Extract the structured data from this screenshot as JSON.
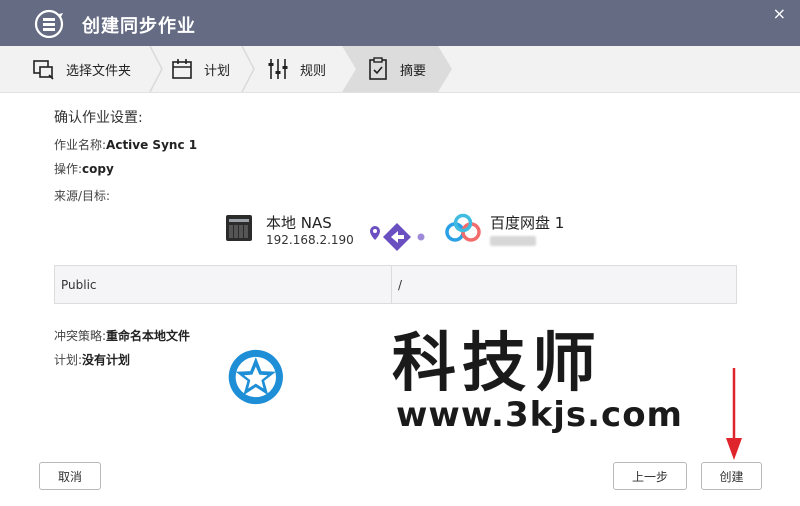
{
  "window": {
    "title": "创建同步作业",
    "close_glyph": "×"
  },
  "wizard": {
    "steps": [
      {
        "label": "选择文件夹",
        "icon": "folder-select-icon"
      },
      {
        "label": "计划",
        "icon": "calendar-icon"
      },
      {
        "label": "规则",
        "icon": "sliders-icon"
      },
      {
        "label": "摘要",
        "icon": "clipboard-icon",
        "active": true
      }
    ]
  },
  "summary": {
    "heading": "确认作业设置:",
    "job_name_label": "作业名称:",
    "job_name_value": "Active Sync 1",
    "operation_label": "操作:",
    "operation_value": "copy",
    "source_target_label": "来源/目标:",
    "source": {
      "name": "本地 NAS",
      "ip": "192.168.2.190"
    },
    "target": {
      "name": "百度网盘 1"
    },
    "folder_pair": {
      "source": "Public",
      "target": "/"
    },
    "conflict_label": "冲突策略:",
    "conflict_value": "重命名本地文件",
    "schedule_label": "计划:",
    "schedule_value": "没有计划"
  },
  "watermark": {
    "text": "科技师",
    "url": "www.3kjs.com"
  },
  "buttons": {
    "cancel": "取消",
    "prev": "上一步",
    "create": "创建"
  },
  "colors": {
    "titlebar": "#646b82",
    "accent_purple": "#6a4fc1",
    "watermark_blue": "#1e8fd6",
    "arrow_red": "#e0242b"
  }
}
